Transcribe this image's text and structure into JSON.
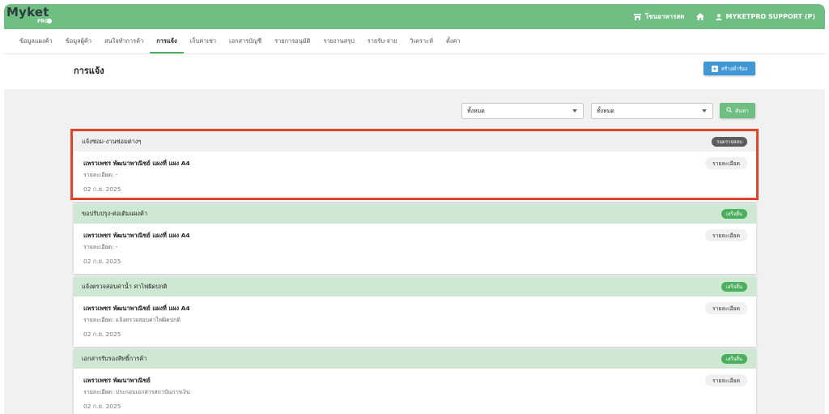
{
  "colors": {
    "brand": "#6fbf82",
    "primary": "#3f97d6",
    "pending": "#5c5c5c",
    "done": "#4caf5e",
    "done_head": "#cfe8d3",
    "alert": "#e0452c"
  },
  "header": {
    "logo_word": "Myket",
    "logo_sub": "PRO",
    "store_link": "โซนอาหารสด",
    "user_label": "MYKETPRO SUPPORT (P)"
  },
  "nav": {
    "tabs": [
      {
        "label": "ข้อมูลแผงค้า"
      },
      {
        "label": "ข้อมูลผู้ค้า"
      },
      {
        "label": "สนใจทำการค้า"
      },
      {
        "label": "การแจ้ง",
        "active": true
      },
      {
        "label": "เก็บค่าเช่า"
      },
      {
        "label": "เอกสารบัญชี"
      },
      {
        "label": "รายการอนุมัติ"
      },
      {
        "label": "รายงานสรุป"
      },
      {
        "label": "รายรับ-จ่าย"
      },
      {
        "label": "วิเคราะห์"
      },
      {
        "label": "ตั้งค่า"
      }
    ]
  },
  "page": {
    "title": "การแจ้ง",
    "create_label": "สร้างคำร้อง"
  },
  "filters": {
    "select_1": "ทั้งหมด",
    "select_2": "ทั้งหมด",
    "search_label": "ค้นหา"
  },
  "cards": [
    {
      "category": "แจ้งซ่อม-งานซ่อมต่างๆ",
      "status": "รอตรวจสอบ",
      "seller": "แพรวเพชร พัฒนาพาณิชย์ แผงที่ แผง A4",
      "detail": "รายละเอียด: -",
      "date": "02 ก.ย. 2025",
      "detail_btn": "รายละเอียด"
    },
    {
      "category": "ขอปรับปรุง-ต่อเติมแผงค้า",
      "status": "เสร็จสิ้น",
      "seller": "แพรวเพชร พัฒนาพาณิชย์ แผงที่ แผง A4",
      "detail": "รายละเอียด: -",
      "date": "02 ก.ย. 2025",
      "detail_btn": "รายละเอียด"
    },
    {
      "category": "แจ้งตรวจสอบค่าน้ำ ค่าไฟผิดปกติ",
      "status": "เสร็จสิ้น",
      "seller": "แพรวเพชร พัฒนาพาณิชย์ แผงที่ แผง A4",
      "detail": "รายละเอียด: แจ้งตรวจสอบค่าไฟผิดปกติ",
      "date": "02 ก.ย. 2025",
      "detail_btn": "รายละเอียด"
    },
    {
      "category": "เอกสารรับรองสิทธิ์การค้า",
      "status": "เสร็จสิ้น",
      "seller": "แพรวเพชร พัฒนาพาณิชย์",
      "detail": "รายละเอียด: ประกอบเอกสารสถาบันการเงิน",
      "date": "02 ก.ย. 2025",
      "detail_btn": "รายละเอียด"
    }
  ]
}
